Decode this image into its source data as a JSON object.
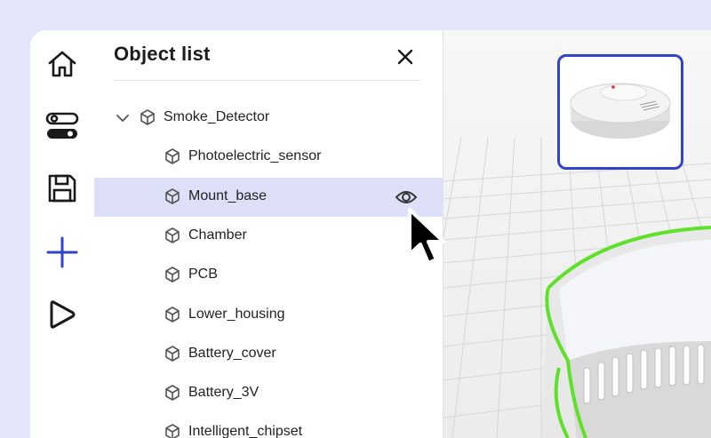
{
  "panel": {
    "title": "Object list",
    "close_icon": "close-icon"
  },
  "toolbar": {
    "items": [
      {
        "icon": "home-icon"
      },
      {
        "icon": "toggles-icon"
      },
      {
        "icon": "save-icon"
      },
      {
        "icon": "add-icon"
      },
      {
        "icon": "play-icon"
      }
    ]
  },
  "tree": {
    "items": [
      {
        "label": "Smoke_Detector",
        "level": 0,
        "expanded": true
      },
      {
        "label": "Photoelectric_sensor",
        "level": 1
      },
      {
        "label": "Mount_base",
        "level": 1,
        "selected": true,
        "action_icon": "eye-icon"
      },
      {
        "label": "Chamber",
        "level": 1
      },
      {
        "label": "PCB",
        "level": 1
      },
      {
        "label": "Lower_housing",
        "level": 1
      },
      {
        "label": "Battery_cover",
        "level": 1
      },
      {
        "label": "Battery_3V",
        "level": 1
      },
      {
        "label": "Intelligent_chipset",
        "level": 1
      }
    ]
  },
  "viewport": {
    "thumbnail_number": "1",
    "highlight_color": "#5fe02a",
    "accent_color": "#3344cc"
  }
}
